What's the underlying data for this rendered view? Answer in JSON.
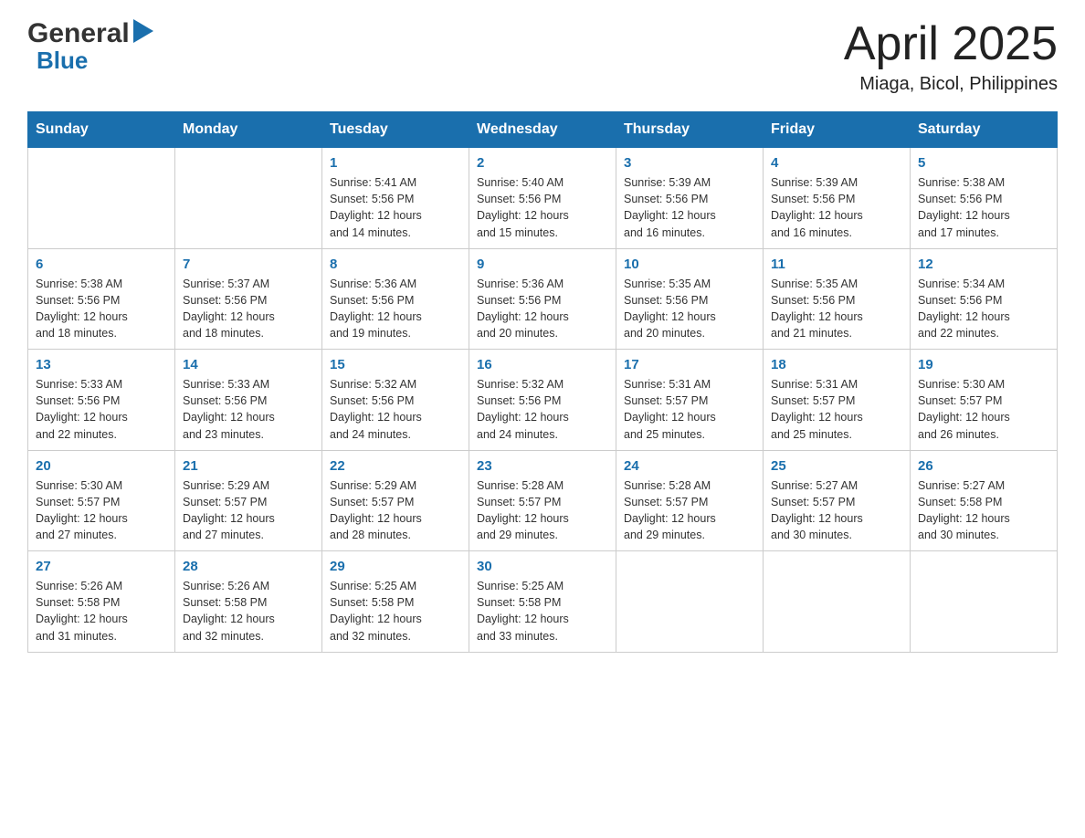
{
  "logo": {
    "general": "General",
    "blue": "Blue",
    "arrow": "▶"
  },
  "header": {
    "title": "April 2025",
    "location": "Miaga, Bicol, Philippines"
  },
  "days_of_week": [
    "Sunday",
    "Monday",
    "Tuesday",
    "Wednesday",
    "Thursday",
    "Friday",
    "Saturday"
  ],
  "weeks": [
    [
      {
        "day": "",
        "info": ""
      },
      {
        "day": "",
        "info": ""
      },
      {
        "day": "1",
        "info": "Sunrise: 5:41 AM\nSunset: 5:56 PM\nDaylight: 12 hours\nand 14 minutes."
      },
      {
        "day": "2",
        "info": "Sunrise: 5:40 AM\nSunset: 5:56 PM\nDaylight: 12 hours\nand 15 minutes."
      },
      {
        "day": "3",
        "info": "Sunrise: 5:39 AM\nSunset: 5:56 PM\nDaylight: 12 hours\nand 16 minutes."
      },
      {
        "day": "4",
        "info": "Sunrise: 5:39 AM\nSunset: 5:56 PM\nDaylight: 12 hours\nand 16 minutes."
      },
      {
        "day": "5",
        "info": "Sunrise: 5:38 AM\nSunset: 5:56 PM\nDaylight: 12 hours\nand 17 minutes."
      }
    ],
    [
      {
        "day": "6",
        "info": "Sunrise: 5:38 AM\nSunset: 5:56 PM\nDaylight: 12 hours\nand 18 minutes."
      },
      {
        "day": "7",
        "info": "Sunrise: 5:37 AM\nSunset: 5:56 PM\nDaylight: 12 hours\nand 18 minutes."
      },
      {
        "day": "8",
        "info": "Sunrise: 5:36 AM\nSunset: 5:56 PM\nDaylight: 12 hours\nand 19 minutes."
      },
      {
        "day": "9",
        "info": "Sunrise: 5:36 AM\nSunset: 5:56 PM\nDaylight: 12 hours\nand 20 minutes."
      },
      {
        "day": "10",
        "info": "Sunrise: 5:35 AM\nSunset: 5:56 PM\nDaylight: 12 hours\nand 20 minutes."
      },
      {
        "day": "11",
        "info": "Sunrise: 5:35 AM\nSunset: 5:56 PM\nDaylight: 12 hours\nand 21 minutes."
      },
      {
        "day": "12",
        "info": "Sunrise: 5:34 AM\nSunset: 5:56 PM\nDaylight: 12 hours\nand 22 minutes."
      }
    ],
    [
      {
        "day": "13",
        "info": "Sunrise: 5:33 AM\nSunset: 5:56 PM\nDaylight: 12 hours\nand 22 minutes."
      },
      {
        "day": "14",
        "info": "Sunrise: 5:33 AM\nSunset: 5:56 PM\nDaylight: 12 hours\nand 23 minutes."
      },
      {
        "day": "15",
        "info": "Sunrise: 5:32 AM\nSunset: 5:56 PM\nDaylight: 12 hours\nand 24 minutes."
      },
      {
        "day": "16",
        "info": "Sunrise: 5:32 AM\nSunset: 5:56 PM\nDaylight: 12 hours\nand 24 minutes."
      },
      {
        "day": "17",
        "info": "Sunrise: 5:31 AM\nSunset: 5:57 PM\nDaylight: 12 hours\nand 25 minutes."
      },
      {
        "day": "18",
        "info": "Sunrise: 5:31 AM\nSunset: 5:57 PM\nDaylight: 12 hours\nand 25 minutes."
      },
      {
        "day": "19",
        "info": "Sunrise: 5:30 AM\nSunset: 5:57 PM\nDaylight: 12 hours\nand 26 minutes."
      }
    ],
    [
      {
        "day": "20",
        "info": "Sunrise: 5:30 AM\nSunset: 5:57 PM\nDaylight: 12 hours\nand 27 minutes."
      },
      {
        "day": "21",
        "info": "Sunrise: 5:29 AM\nSunset: 5:57 PM\nDaylight: 12 hours\nand 27 minutes."
      },
      {
        "day": "22",
        "info": "Sunrise: 5:29 AM\nSunset: 5:57 PM\nDaylight: 12 hours\nand 28 minutes."
      },
      {
        "day": "23",
        "info": "Sunrise: 5:28 AM\nSunset: 5:57 PM\nDaylight: 12 hours\nand 29 minutes."
      },
      {
        "day": "24",
        "info": "Sunrise: 5:28 AM\nSunset: 5:57 PM\nDaylight: 12 hours\nand 29 minutes."
      },
      {
        "day": "25",
        "info": "Sunrise: 5:27 AM\nSunset: 5:57 PM\nDaylight: 12 hours\nand 30 minutes."
      },
      {
        "day": "26",
        "info": "Sunrise: 5:27 AM\nSunset: 5:58 PM\nDaylight: 12 hours\nand 30 minutes."
      }
    ],
    [
      {
        "day": "27",
        "info": "Sunrise: 5:26 AM\nSunset: 5:58 PM\nDaylight: 12 hours\nand 31 minutes."
      },
      {
        "day": "28",
        "info": "Sunrise: 5:26 AM\nSunset: 5:58 PM\nDaylight: 12 hours\nand 32 minutes."
      },
      {
        "day": "29",
        "info": "Sunrise: 5:25 AM\nSunset: 5:58 PM\nDaylight: 12 hours\nand 32 minutes."
      },
      {
        "day": "30",
        "info": "Sunrise: 5:25 AM\nSunset: 5:58 PM\nDaylight: 12 hours\nand 33 minutes."
      },
      {
        "day": "",
        "info": ""
      },
      {
        "day": "",
        "info": ""
      },
      {
        "day": "",
        "info": ""
      }
    ]
  ]
}
